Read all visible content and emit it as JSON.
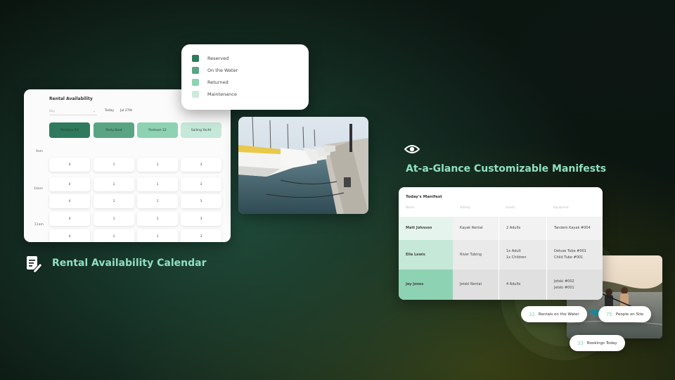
{
  "calendar": {
    "title": "Rental Availability",
    "select_placeholder": "Day",
    "today_label": "Today",
    "date_label": "Jul 27th",
    "resources": [
      {
        "label": "Pontoon 10",
        "color": "#2f7a5c"
      },
      {
        "label": "Party Boat",
        "color": "#5aa484"
      },
      {
        "label": "Pontoon 12",
        "color": "#8ed2b4"
      },
      {
        "label": "Sailing Yacht",
        "color": "#c5e8d8"
      }
    ],
    "time_labels": [
      "9am",
      "10am",
      "11am"
    ],
    "rows": [
      [
        "4",
        "1",
        "1",
        "3"
      ],
      [
        "4",
        "1",
        "1",
        "3"
      ],
      [
        "4",
        "1",
        "1",
        "3"
      ],
      [
        "4",
        "1",
        "1",
        "3"
      ],
      [
        "4",
        "1",
        "1",
        "3"
      ]
    ]
  },
  "legend": {
    "items": [
      {
        "label": "Reserved",
        "color": "#2f7a5c"
      },
      {
        "label": "On the Water",
        "color": "#5aa484"
      },
      {
        "label": "Returned",
        "color": "#8ed2b4"
      },
      {
        "label": "Maintenance",
        "color": "#cdebdd"
      }
    ]
  },
  "features": {
    "calendar_label": "Rental Availability Calendar",
    "manifest_label": "At-a-Glance Customizable Manifests"
  },
  "manifest": {
    "title": "Today's Manifest",
    "columns": [
      "Name",
      "Activity",
      "Guests",
      "Equipment"
    ],
    "rows": [
      {
        "name": "Matt Johnson",
        "activity": "Kayak Rental",
        "guests": [
          "2 Adults"
        ],
        "equipment": [
          "Tandem Kayak #004"
        ],
        "highlight": "#e6f4ee"
      },
      {
        "name": "Ella Lewis",
        "activity": "River Tubing",
        "guests": [
          "1x Adult",
          "1x Children"
        ],
        "equipment": [
          "Deluxe Tube #001",
          "Child Tube #001"
        ],
        "highlight": "#c5e8d8"
      },
      {
        "name": "Jay Jones",
        "activity": "Jetski Rental",
        "guests": [
          "4 Adults"
        ],
        "equipment": [
          "Jetski #002",
          "Jetski #001"
        ],
        "highlight": "#8ed2b4"
      }
    ]
  },
  "stats": [
    {
      "value": "32",
      "label": "Rentals on the Water"
    },
    {
      "value": "75",
      "label": "People on Site"
    },
    {
      "value": "33",
      "label": "Bookings Today"
    }
  ],
  "icons": {
    "calendar_feature": "document-edit-icon",
    "manifest_feature": "eye-icon"
  }
}
